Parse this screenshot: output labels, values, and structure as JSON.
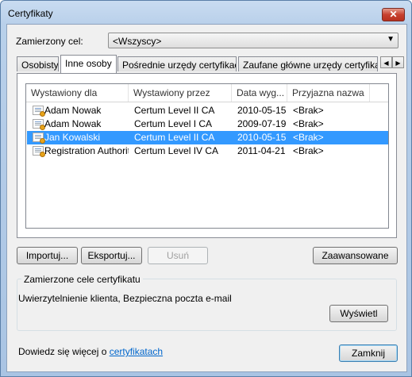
{
  "window": {
    "title": "Certyfikaty",
    "close_glyph": "✕"
  },
  "purpose": {
    "label": "Zamierzony cel:",
    "value": "<Wszyscy>"
  },
  "tabs": [
    {
      "label": "Osobisty"
    },
    {
      "label": "Inne osoby"
    },
    {
      "label": "Pośrednie urzędy certyfikacji"
    },
    {
      "label": "Zaufane główne urzędy certyfikacji"
    }
  ],
  "tab_scroll": {
    "left": "◀",
    "right": "▶"
  },
  "table": {
    "columns": [
      "Wystawiony dla",
      "Wystawiony przez",
      "Data wyg...",
      "Przyjazna nazwa"
    ],
    "rows": [
      {
        "issued_to": "Adam Nowak",
        "issued_by": "Certum Level II CA",
        "expires": "2010-05-15",
        "friendly": "<Brak>",
        "selected": false
      },
      {
        "issued_to": "Adam Nowak",
        "issued_by": "Certum Level I CA",
        "expires": "2009-07-19",
        "friendly": "<Brak>",
        "selected": false
      },
      {
        "issued_to": "Jan Kowalski",
        "issued_by": "Certum Level II CA",
        "expires": "2010-05-15",
        "friendly": "<Brak>",
        "selected": true
      },
      {
        "issued_to": "Registration Authority",
        "issued_by": "Certum Level IV CA",
        "expires": "2011-04-21",
        "friendly": "<Brak>",
        "selected": false
      }
    ]
  },
  "buttons": {
    "import": "Importuj...",
    "export": "Eksportuj...",
    "remove": "Usuń",
    "advanced": "Zaawansowane",
    "view": "Wyświetl",
    "close": "Zamknij"
  },
  "purposes_group": {
    "title": "Zamierzone cele certyfikatu",
    "text": "Uwierzytelnienie klienta, Bezpieczna poczta e-mail"
  },
  "footer": {
    "prefix": "Dowiedz się więcej o ",
    "link": "certyfikatach"
  },
  "colors": {
    "selection": "#3399ff",
    "link": "#0066cc"
  }
}
